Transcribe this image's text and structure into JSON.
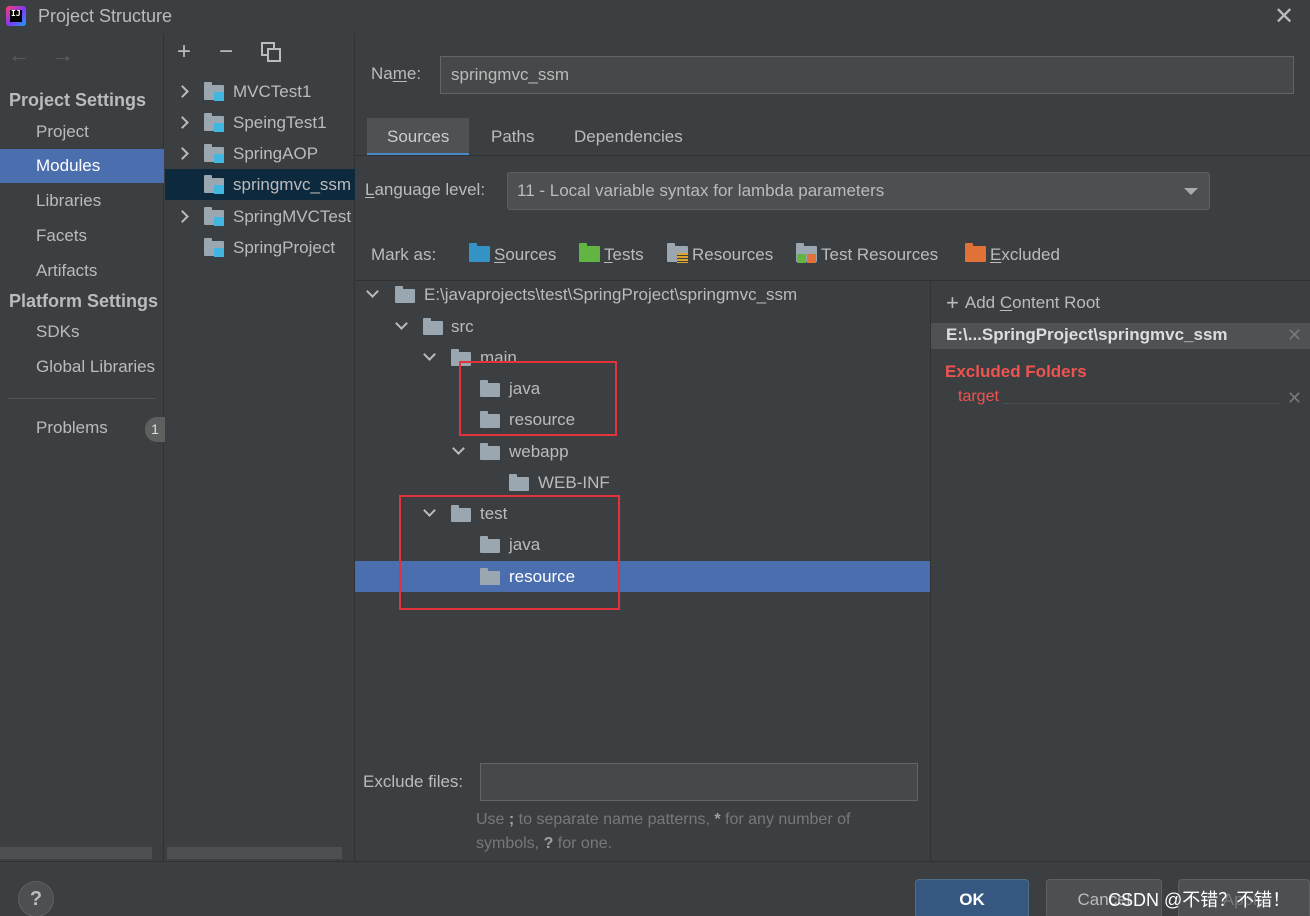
{
  "window": {
    "title": "Project Structure"
  },
  "nav": {
    "project_settings_head": "Project Settings",
    "platform_settings_head": "Platform Settings",
    "items": [
      {
        "label": "Project"
      },
      {
        "label": "Modules"
      },
      {
        "label": "Libraries"
      },
      {
        "label": "Facets"
      },
      {
        "label": "Artifacts"
      },
      {
        "label": "SDKs"
      },
      {
        "label": "Global Libraries"
      },
      {
        "label": "Problems"
      }
    ],
    "problems_count": "1"
  },
  "modules": [
    {
      "label": "MVCTest1"
    },
    {
      "label": "SpeingTest1"
    },
    {
      "label": "SpringAOP"
    },
    {
      "label": "springmvc_ssm"
    },
    {
      "label": "SpringMVCTest"
    },
    {
      "label": "SpringProject"
    }
  ],
  "main": {
    "name_label_pre": "Na",
    "name_label_u": "m",
    "name_label_post": "e:",
    "name_value": "springmvc_ssm",
    "tabs": [
      {
        "label": "Sources"
      },
      {
        "label": "Paths"
      },
      {
        "label": "Dependencies"
      }
    ],
    "language_label_u": "L",
    "language_label_rest": "anguage level:",
    "language_value": "11 - Local variable syntax for lambda parameters",
    "mark_as_label": "Mark as:",
    "mark_buttons": [
      {
        "u": "S",
        "rest": "ources",
        "color": "#3592c4"
      },
      {
        "u": "T",
        "rest": "ests",
        "color": "#62b543"
      },
      {
        "u": "",
        "rest": "Resources",
        "color": "#9aa7b0"
      },
      {
        "u": "",
        "rest": "Test Resources",
        "color": "#9aa7b0"
      },
      {
        "u": "E",
        "rest": "xcluded",
        "color": "#e07238"
      }
    ]
  },
  "tree": [
    {
      "label": "E:\\javaprojects\\test\\SpringProject\\springmvc_ssm"
    },
    {
      "label": "src"
    },
    {
      "label": "main"
    },
    {
      "label": "java"
    },
    {
      "label": "resource"
    },
    {
      "label": "webapp"
    },
    {
      "label": "WEB-INF"
    },
    {
      "label": "test"
    },
    {
      "label": "java"
    },
    {
      "label": "resource"
    }
  ],
  "exclude": {
    "label": "Exclude files:",
    "value": "",
    "hint_pre": "Use ",
    "hint_b1": ";",
    "hint_mid1": " to separate name patterns, ",
    "hint_b2": "*",
    "hint_mid2": " for any number of symbols, ",
    "hint_b3": "?",
    "hint_post": " for one."
  },
  "content_root": {
    "add_label_pre": "Add ",
    "add_label_u": "C",
    "add_label_post": "ontent Root",
    "root_path": "E:\\...SpringProject\\springmvc_ssm",
    "excluded_head": "Excluded Folders",
    "excluded_item": "target"
  },
  "buttons": {
    "help": "?",
    "ok": "OK",
    "cancel": "Cancel",
    "apply": "Apply"
  },
  "watermark": "CSDN @不错？不错！"
}
